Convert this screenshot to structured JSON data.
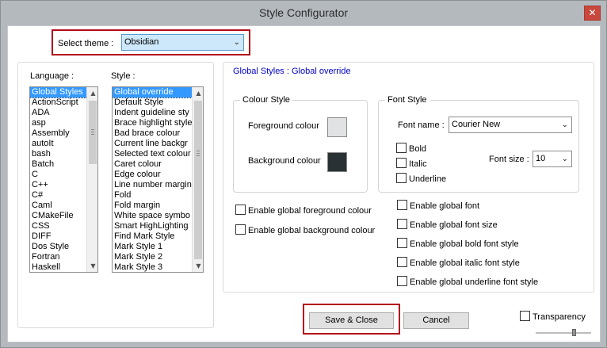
{
  "window": {
    "title": "Style Configurator",
    "close_glyph": "✕"
  },
  "theme": {
    "label": "Select theme :",
    "value": "Obsidian"
  },
  "language": {
    "label": "Language :",
    "items": [
      "Global Styles",
      "ActionScript",
      "ADA",
      "asp",
      "Assembly",
      "autoIt",
      "bash",
      "Batch",
      "C",
      "C++",
      "C#",
      "Caml",
      "CMakeFile",
      "CSS",
      "DIFF",
      "Dos Style",
      "Fortran",
      "Haskell"
    ],
    "selected": "Global Styles"
  },
  "style": {
    "label": "Style :",
    "items": [
      "Global override",
      "Default Style",
      "Indent guideline sty",
      "Brace highlight style",
      "Bad brace colour",
      "Current line backgr",
      "Selected text colour",
      "Caret colour",
      "Edge colour",
      "Line number margin",
      "Fold",
      "Fold margin",
      "White space symbo",
      "Smart HighLighting",
      "Find Mark Style",
      "Mark Style 1",
      "Mark Style 2",
      "Mark Style 3"
    ],
    "selected": "Global override"
  },
  "breadcrumb": "Global Styles : Global override",
  "colour_style": {
    "title": "Colour Style",
    "foreground_label": "Foreground colour",
    "background_label": "Background colour",
    "foreground_color": "#e0e2e4",
    "background_color": "#293134"
  },
  "font_style": {
    "title": "Font Style",
    "font_name_label": "Font name :",
    "font_name_value": "Courier New",
    "bold_label": "Bold",
    "italic_label": "Italic",
    "underline_label": "Underline",
    "font_size_label": "Font size :",
    "font_size_value": "10"
  },
  "global_options": {
    "enable_fg": "Enable global foreground colour",
    "enable_bg": "Enable global background colour",
    "enable_font": "Enable global font",
    "enable_font_size": "Enable global font size",
    "enable_bold": "Enable global bold font style",
    "enable_italic": "Enable global italic font style",
    "enable_underline": "Enable global underline font style"
  },
  "buttons": {
    "save_close": "Save & Close",
    "cancel": "Cancel"
  },
  "transparency": {
    "label": "Transparency"
  },
  "icons": {
    "dropdown": "chevron-down-icon",
    "scroll_up": "arrow-up-icon",
    "scroll_down": "arrow-down-icon",
    "close": "close-icon"
  },
  "colors": {
    "highlight_red": "#b30c1b",
    "selection_blue": "#3399ff",
    "link_blue": "#0000c8"
  }
}
